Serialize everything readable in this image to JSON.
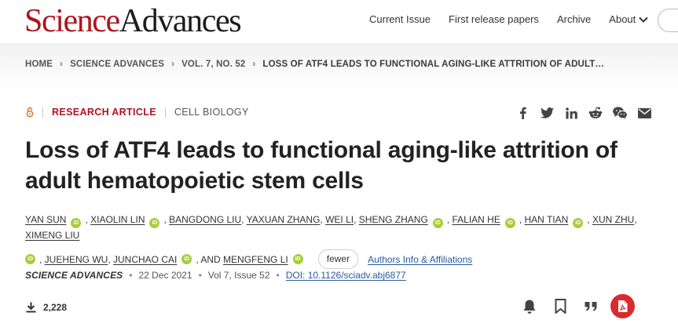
{
  "header": {
    "logo_part1": "Science",
    "logo_part2": "Advances",
    "nav": [
      {
        "label": "Current Issue"
      },
      {
        "label": "First release papers"
      },
      {
        "label": "Archive"
      },
      {
        "label": "About"
      }
    ]
  },
  "breadcrumb": [
    {
      "label": "HOME"
    },
    {
      "label": "SCIENCE ADVANCES"
    },
    {
      "label": "VOL. 7, NO. 52"
    },
    {
      "label": "LOSS OF ATF4 LEADS TO FUNCTIONAL AGING-LIKE ATTRITION OF ADULT…"
    }
  ],
  "article": {
    "type": "RESEARCH ARTICLE",
    "subject": "CELL BIOLOGY",
    "title": "Loss of ATF4 leads to functional aging-like attrition of adult hematopoietic stem cells",
    "authors": [
      {
        "name": "YAN SUN",
        "orcid": true,
        "comma": true
      },
      {
        "name": "XIAOLIN LIN",
        "orcid": true,
        "comma": true
      },
      {
        "name": "BANGDONG LIU",
        "orcid": false,
        "comma": true
      },
      {
        "name": "YAXUAN ZHANG",
        "orcid": false,
        "comma": true
      },
      {
        "name": "WEI LI",
        "orcid": false,
        "comma": true
      },
      {
        "name": "SHENG ZHANG",
        "orcid": true,
        "comma": true
      },
      {
        "name": "FALIAN HE",
        "orcid": true,
        "comma": true
      },
      {
        "name": "HAN TIAN",
        "orcid": true,
        "comma": true
      },
      {
        "name": "XUN ZHU",
        "orcid": false,
        "comma": true
      },
      {
        "name": "XIMENG LIU",
        "orcid": true,
        "comma": true
      },
      {
        "name": "JUEHENG WU",
        "orcid": false,
        "comma": true
      },
      {
        "name": "JUNCHAO CAI",
        "orcid": true,
        "comma": true
      }
    ],
    "and_text": ", AND",
    "last_author": "MENGFENG LI",
    "orcid_glyph": "iD",
    "fewer_label": "fewer",
    "affiliations_label": "Authors Info & Affiliations",
    "journal": "SCIENCE ADVANCES",
    "date": "22 Dec 2021",
    "volume_issue": "Vol 7, Issue 52",
    "doi": "DOI: 10.1126/sciadv.abj6877",
    "downloads": "2,228",
    "separator": "•"
  },
  "share_icons": [
    "facebook-icon",
    "twitter-icon",
    "linkedin-icon",
    "reddit-icon",
    "wechat-icon",
    "email-icon"
  ],
  "tool_icons": [
    "bell-icon",
    "bookmark-icon",
    "quote-icon",
    "pdf-icon"
  ],
  "colors": {
    "brand_red": "#b0141f",
    "link_blue": "#2a5a9a",
    "orcid_green": "#a6ce39",
    "pdf_red": "#d92b2b"
  }
}
